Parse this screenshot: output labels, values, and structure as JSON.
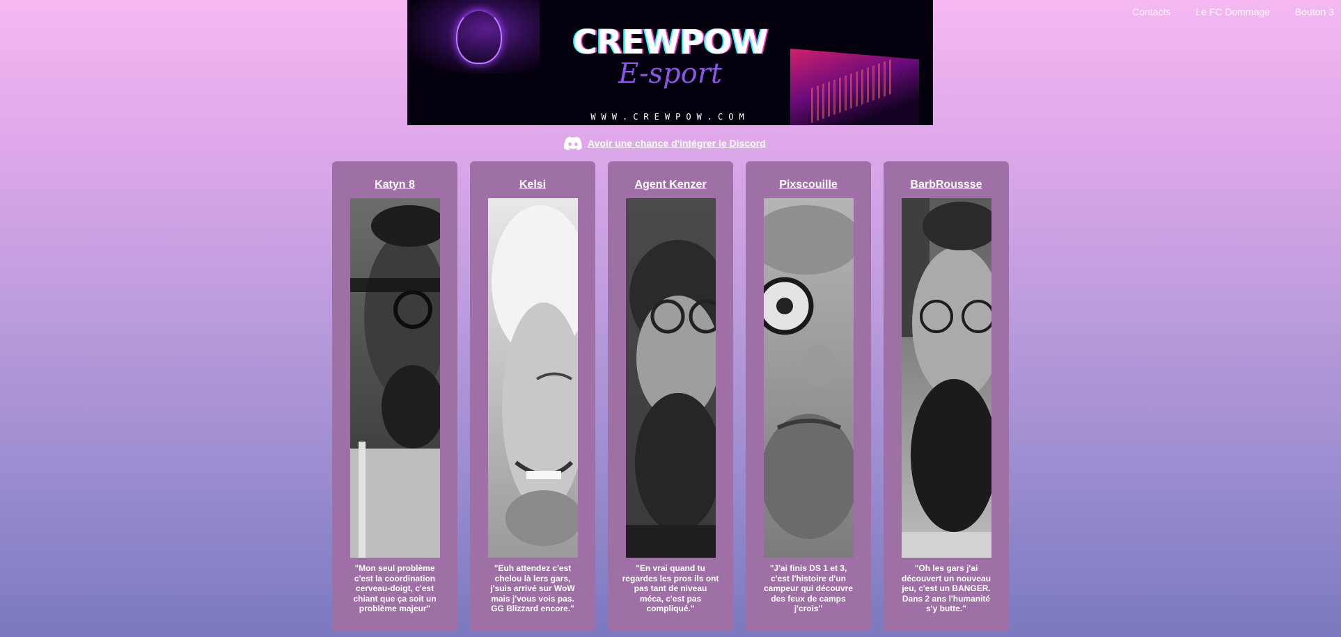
{
  "nav": {
    "items": [
      "Contacts",
      "Le FC Dommage",
      "Bouton 3"
    ]
  },
  "banner": {
    "title": "CREWPOW",
    "subtitle": "E-sport",
    "url": "WWW.CREWPOW.COM"
  },
  "discord": {
    "icon": "discord-icon",
    "link_text": "Avoir une chance d'intégrer le Discord"
  },
  "members": [
    {
      "name": "Katyn 8",
      "quote": "\"Mon seul problème c'est la coordination cerveau-doigt, c'est chiant que ça soit un problème majeur\""
    },
    {
      "name": "Kelsi",
      "quote": "\"Euh attendez c'est chelou là lers gars, j'suis arrivé sur WoW mais j'vous vois pas. GG Blizzard encore.\""
    },
    {
      "name": "Agent Kenzer",
      "quote": "\"En vrai quand tu regardes les pros ils ont pas tant de niveau méca, c'est pas compliqué.\""
    },
    {
      "name": "Pixscouille",
      "quote": "\"J'ai finis DS 1 et 3, c'est l'histoire d'un campeur qui découvre des feux de camps j'crois\""
    },
    {
      "name": "BarbRoussse",
      "quote": "\"Oh les gars j'ai découvert un nouveau jeu, c'est un BANGER. Dans 2 ans l'humanité s'y butte.\""
    }
  ],
  "colors": {
    "card_bg": "#9f70a6",
    "banner_bg": "#05000e",
    "gradient_top": "#f5b8f3",
    "gradient_bottom": "#7b79bf"
  }
}
